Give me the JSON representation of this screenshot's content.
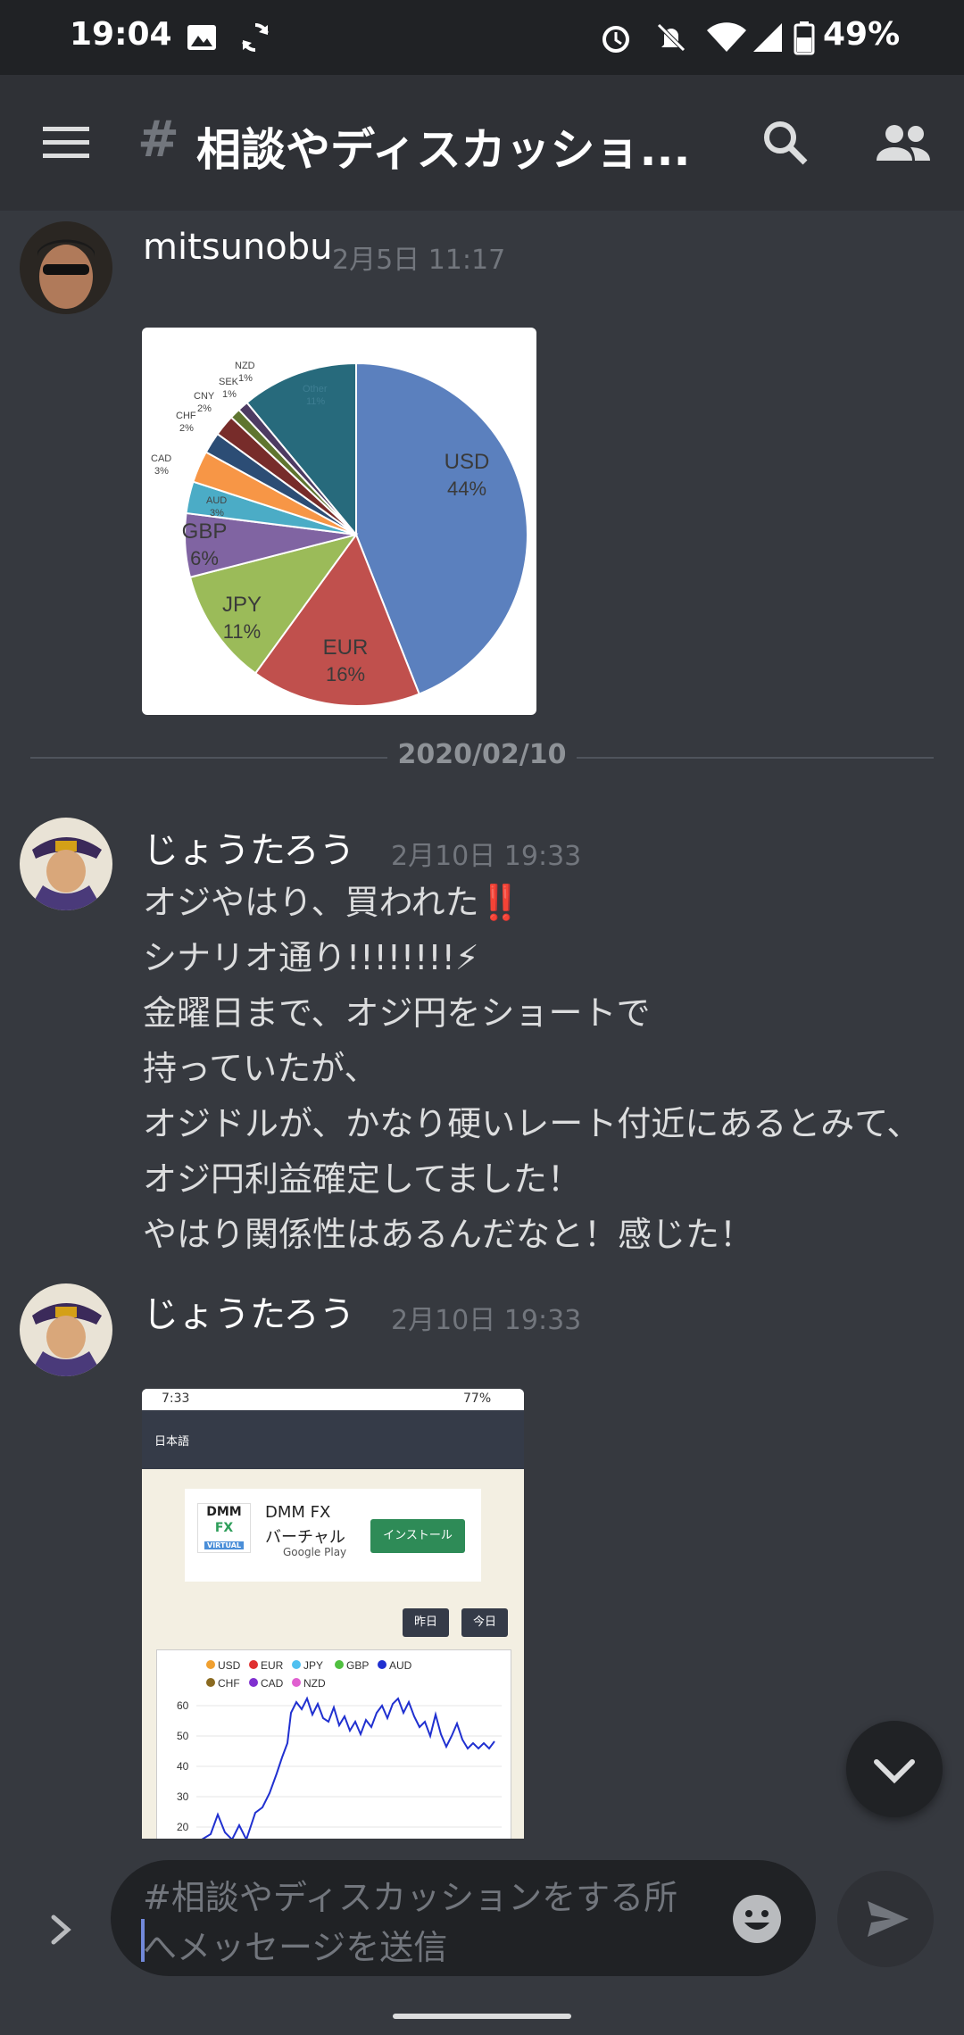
{
  "status_bar": {
    "time": "19:04",
    "battery": "49%"
  },
  "header": {
    "hash": "#",
    "channel_title": "相談やディスカッショ..."
  },
  "messages": [
    {
      "author": "mitsunobu",
      "timestamp": "2月5日 11:17"
    },
    {
      "author": "じょうたろう",
      "timestamp": "2月10日 19:33",
      "lines": [
        "オジやはり、買われた‼️",
        "シナリオ通り!!!!!!!!⚡",
        "金曜日まで、オジ円をショートで",
        "持っていたが、",
        "オジドルが、かなり硬いレート付近にあるとみて、",
        "オジ円利益確定してました！",
        "やはり関係性はあるんだなと！感じた！"
      ]
    },
    {
      "author": "じょうたろう",
      "timestamp": "2月10日 19:33"
    }
  ],
  "date_divider": "2020/02/10",
  "pie_labels": [
    {
      "name": "USD",
      "pct": "44%"
    },
    {
      "name": "EUR",
      "pct": "16%"
    },
    {
      "name": "JPY",
      "pct": "11%"
    },
    {
      "name": "GBP",
      "pct": "6%"
    },
    {
      "name": "AUD",
      "pct": "3%"
    },
    {
      "name": "CAD",
      "pct": "3%"
    },
    {
      "name": "CHF",
      "pct": "2%"
    },
    {
      "name": "CNY",
      "pct": "2%"
    },
    {
      "name": "SEK",
      "pct": "1%"
    },
    {
      "name": "NZD",
      "pct": "1%"
    },
    {
      "name": "Other",
      "pct": "11%"
    }
  ],
  "screenshot": {
    "status_time": "7:33",
    "status_battery": "77%",
    "language": "日本語",
    "ad_title": "DMM FX",
    "ad_subtitle": "バーチャル",
    "ad_store": "Google Play",
    "ad_button": "インストール",
    "ad_logo": "DMM",
    "ad_logo_fx": "FX",
    "ad_logo_virtual": "VIRTUAL",
    "btn_yesterday": "昨日",
    "btn_today": "今日",
    "legend": [
      "USD",
      "EUR",
      "JPY",
      "GBP",
      "AUD",
      "CHF",
      "CAD",
      "NZD"
    ],
    "legend_colors": [
      "#f0a030",
      "#e03030",
      "#50c0f0",
      "#50c040",
      "#2030d0",
      "#8a6a20",
      "#8030d0",
      "#e060d0"
    ],
    "y_ticks": [
      "60",
      "50",
      "40",
      "30",
      "20"
    ]
  },
  "input": {
    "placeholder": "#相談やディスカッションをする所へメッセージを送信"
  },
  "chart_data": {
    "type": "pie",
    "categories": [
      "USD",
      "EUR",
      "JPY",
      "GBP",
      "AUD",
      "CAD",
      "CHF",
      "CNY",
      "SEK",
      "NZD",
      "Other"
    ],
    "values": [
      44,
      16,
      11,
      6,
      3,
      3,
      2,
      2,
      1,
      1,
      11
    ],
    "colors": [
      "#5b80be",
      "#c0504d",
      "#9bbb59",
      "#8064a2",
      "#4bacc6",
      "#f79646",
      "#2c4d75",
      "#772c2a",
      "#5f7530",
      "#4d3b62",
      "#276a7c"
    ]
  }
}
